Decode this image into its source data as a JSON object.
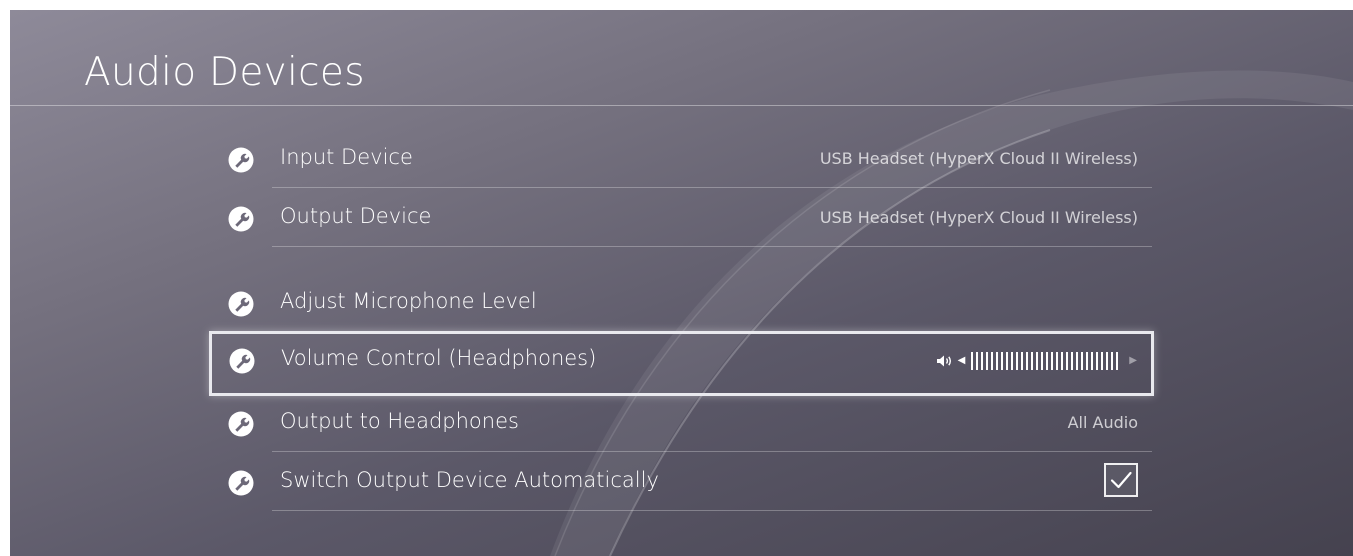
{
  "page": {
    "title": "Audio Devices"
  },
  "menu": {
    "items": [
      {
        "label": "Input Device",
        "value": "USB Headset (HyperX Cloud II Wireless)",
        "icon": "wrench-icon"
      },
      {
        "label": "Output Device",
        "value": "USB Headset (HyperX Cloud II Wireless)",
        "icon": "wrench-icon"
      },
      {
        "label": "Adjust Microphone Level",
        "value": "",
        "icon": "wrench-icon"
      },
      {
        "label": "Volume Control (Headphones)",
        "value": "",
        "icon": "wrench-icon",
        "selected": true
      },
      {
        "label": "Output to Headphones",
        "value": "All Audio",
        "icon": "wrench-icon"
      },
      {
        "label": "Switch Output Device Automatically",
        "value": "",
        "icon": "wrench-icon"
      }
    ]
  },
  "volume": {
    "level_fraction": 1.0,
    "icons": [
      "speaker-icon",
      "left-arrow-icon",
      "right-arrow-icon"
    ]
  },
  "auto_switch": {
    "checked": true,
    "icon": "checkmark-icon"
  },
  "colors": {
    "text": "#ffffff",
    "selection_border": "#e9e9ee"
  }
}
